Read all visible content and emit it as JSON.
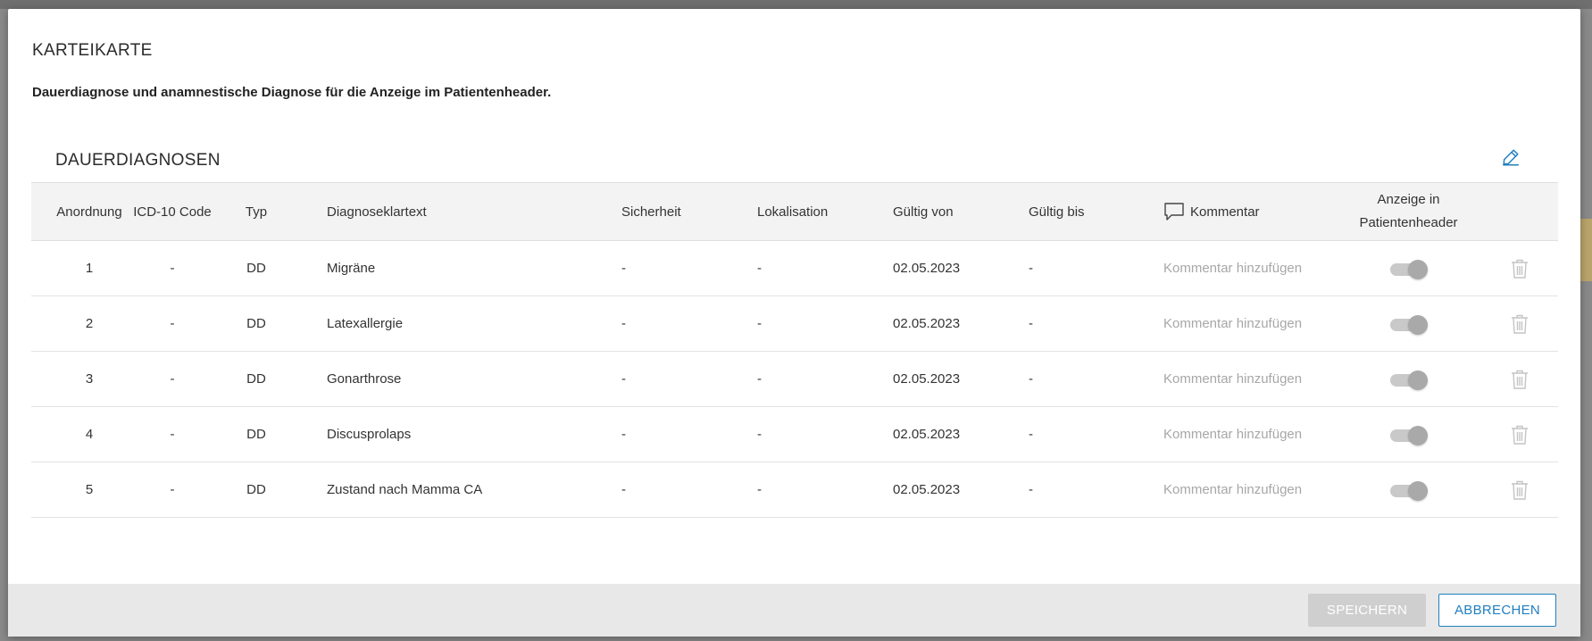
{
  "dialog": {
    "title": "KARTEIKARTE",
    "subtitle": "Dauerdiagnose und anamnestische Diagnose für die Anzeige im Patientenheader."
  },
  "section": {
    "title": "DAUERDIAGNOSEN",
    "edit_icon": "pencil-icon"
  },
  "table": {
    "headers": {
      "order": "Anordnung",
      "icd": "ICD-10 Code",
      "typ": "Typ",
      "diag": "Diagnoseklartext",
      "sicherheit": "Sicherheit",
      "lokalisation": "Lokalisation",
      "gueltig_von": "Gültig von",
      "gueltig_bis": "Gültig bis",
      "kommentar": "Kommentar",
      "anzeige_line1": "Anzeige in",
      "anzeige_line2": "Patientenheader"
    },
    "comment_icon": "speech-bubble-icon",
    "rows": [
      {
        "order": "1",
        "icd": "-",
        "typ": "DD",
        "diag": "Migräne",
        "sicherheit": "-",
        "lokalisation": "-",
        "gueltig_von": "02.05.2023",
        "gueltig_bis": "-",
        "kommentar_placeholder": "Kommentar hinzufügen",
        "anzeige": true
      },
      {
        "order": "2",
        "icd": "-",
        "typ": "DD",
        "diag": "Latexallergie",
        "sicherheit": "-",
        "lokalisation": "-",
        "gueltig_von": "02.05.2023",
        "gueltig_bis": "-",
        "kommentar_placeholder": "Kommentar hinzufügen",
        "anzeige": true
      },
      {
        "order": "3",
        "icd": "-",
        "typ": "DD",
        "diag": "Gonarthrose",
        "sicherheit": "-",
        "lokalisation": "-",
        "gueltig_von": "02.05.2023",
        "gueltig_bis": "-",
        "kommentar_placeholder": "Kommentar hinzufügen",
        "anzeige": true
      },
      {
        "order": "4",
        "icd": "-",
        "typ": "DD",
        "diag": "Discusprolaps",
        "sicherheit": "-",
        "lokalisation": "-",
        "gueltig_von": "02.05.2023",
        "gueltig_bis": "-",
        "kommentar_placeholder": "Kommentar hinzufügen",
        "anzeige": true
      },
      {
        "order": "5",
        "icd": "-",
        "typ": "DD",
        "diag": "Zustand nach Mamma CA",
        "sicherheit": "-",
        "lokalisation": "-",
        "gueltig_von": "02.05.2023",
        "gueltig_bis": "-",
        "kommentar_placeholder": "Kommentar hinzufügen",
        "anzeige": true
      }
    ],
    "delete_icon": "trash-icon"
  },
  "footer": {
    "save_label": "SPEICHERN",
    "cancel_label": "ABBRECHEN"
  },
  "colors": {
    "accent": "#1f7fc0",
    "disabled_button": "#cfcfcf",
    "header_bg": "#f3f3f3",
    "footer_bg": "#e8e8e8"
  }
}
